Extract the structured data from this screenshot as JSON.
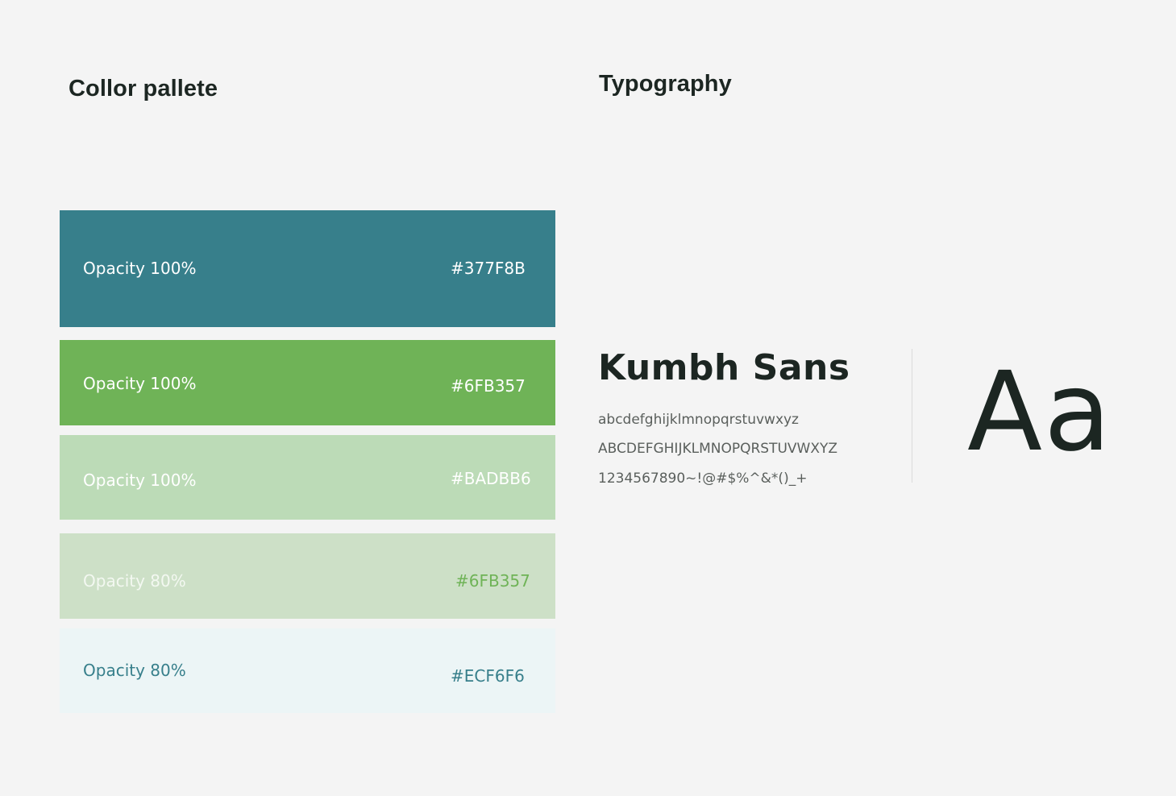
{
  "palette": {
    "title": "Collor pallete",
    "swatches": [
      {
        "opacity": "Opacity 100%",
        "hex": "#377F8B",
        "bg": "#377F8B",
        "label_color": "#ffffff",
        "hex_color": "#ffffff"
      },
      {
        "opacity": "Opacity 100%",
        "hex": "#6FB357",
        "bg": "#6FB357",
        "label_color": "#ffffff",
        "hex_color": "#ffffff"
      },
      {
        "opacity": "Opacity 100%",
        "hex": "#BADBB6",
        "bg": "#BCDBB7",
        "label_color": "#ffffff",
        "hex_color": "#ffffff"
      },
      {
        "opacity": "Opacity 80%",
        "hex": "#6FB357",
        "bg": "#CDE0C7",
        "label_color": "#f3f8f1",
        "hex_color": "#6FB357"
      },
      {
        "opacity": "Opacity 80%",
        "hex": "#ECF6F6",
        "bg": "#ECF5F6",
        "label_color": "#377F8B",
        "hex_color": "#377F8B"
      }
    ]
  },
  "typography": {
    "title": "Typography",
    "font_name": "Kumbh Sans",
    "lowercase": "abcdefghijklmnopqrstuvwxyz",
    "uppercase": "ABCDEFGHIJKLMNOPQRSTUVWXYZ",
    "numbers_symbols": "1234567890~!@#$%^&*()_+",
    "specimen": "Aa"
  }
}
